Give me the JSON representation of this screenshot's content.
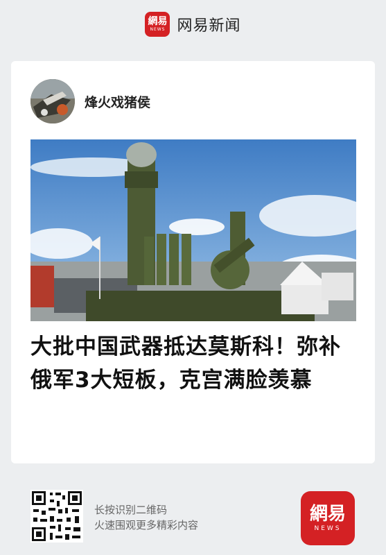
{
  "header": {
    "logo_cn": "網易",
    "logo_en": "NEWS",
    "brand": "网易新闻"
  },
  "article": {
    "author": "烽火戏猪侯",
    "headline": "大批中国武器抵达莫斯科！弥补俄军3大短板，克宫满脸羡慕",
    "photo_subject": "surface-to-air-missile-launcher"
  },
  "footer": {
    "qr_line1": "长按识别二维码",
    "qr_line2": "火速围观更多精彩内容",
    "logo_cn": "網易",
    "logo_en": "NEWS"
  },
  "colors": {
    "brand_red": "#d42124",
    "page_bg": "#eceef0",
    "sky": "#4e86c8"
  }
}
